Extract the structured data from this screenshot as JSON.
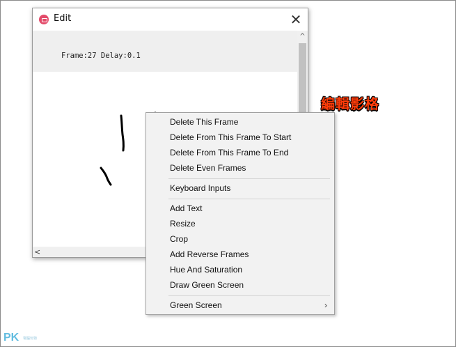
{
  "window": {
    "title": "Edit",
    "close_glyph": "✕",
    "frame_info": "Frame:27 Delay:0.1"
  },
  "scrollbars": {
    "up_arrow": "^",
    "left_arrow": "<"
  },
  "context_menu": {
    "group1": [
      "Delete This Frame",
      "Delete From This Frame To Start",
      "Delete From This Frame To End",
      "Delete Even Frames"
    ],
    "group2": [
      "Keyboard Inputs"
    ],
    "group3": [
      "Add Text",
      "Resize",
      "Crop",
      "Add Reverse Frames",
      "Hue And Saturation",
      "Draw Green Screen"
    ],
    "group4": [
      "Green Screen"
    ],
    "submenu_arrow": "›"
  },
  "annotation": "編輯影格",
  "watermark": {
    "logo": "PK",
    "tagline": "電腦玩物"
  },
  "colors": {
    "annotation": "#ff3c0a",
    "app_icon": "#e34b6a",
    "watermark": "#63bde0"
  },
  "icons": {
    "app": "camera-icon",
    "close": "close-icon",
    "submenu": "chevron-right-icon"
  }
}
